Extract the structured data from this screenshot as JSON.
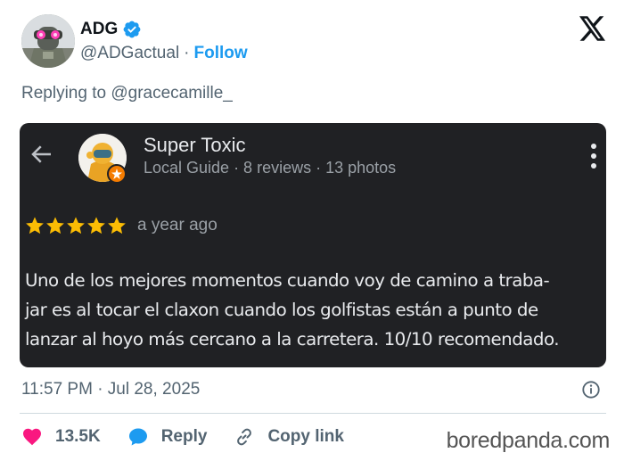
{
  "tweet": {
    "display_name": "ADG",
    "handle": "@ADGactual",
    "separator": "·",
    "follow_label": "Follow",
    "replying_to": "Replying to @gracecamille_",
    "timestamp": "11:57 PM · Jul 28, 2025"
  },
  "review_card": {
    "reviewer_name": "Super Toxic",
    "reviewer_meta": "Local Guide · 8 reviews · 13 photos",
    "rating": 5,
    "review_time": "a year ago",
    "review_lines": [
      "Uno de los mejores momentos cuando voy de camino a traba-",
      "jar es al tocar el claxon cuando los golfistas están a punto de",
      "lanzar al hoyo más cercano a la carretera. 10/10 recomendado."
    ]
  },
  "actions": {
    "likes": "13.5K",
    "reply": "Reply",
    "copy_link": "Copy link"
  },
  "watermark": "boredpanda.com",
  "colors": {
    "verified": "#1d9bf0",
    "follow": "#1d9bf0",
    "heart": "#f91880",
    "reply_bubble": "#1d9bf0",
    "card_bg": "#202124",
    "star": "#fbbc04",
    "guide_badge": "#f57c00"
  },
  "icons": [
    "verified-badge-icon",
    "x-logo-icon",
    "back-arrow-icon",
    "more-vert-icon",
    "star-icon",
    "info-icon",
    "heart-icon",
    "reply-bubble-icon",
    "link-icon"
  ]
}
